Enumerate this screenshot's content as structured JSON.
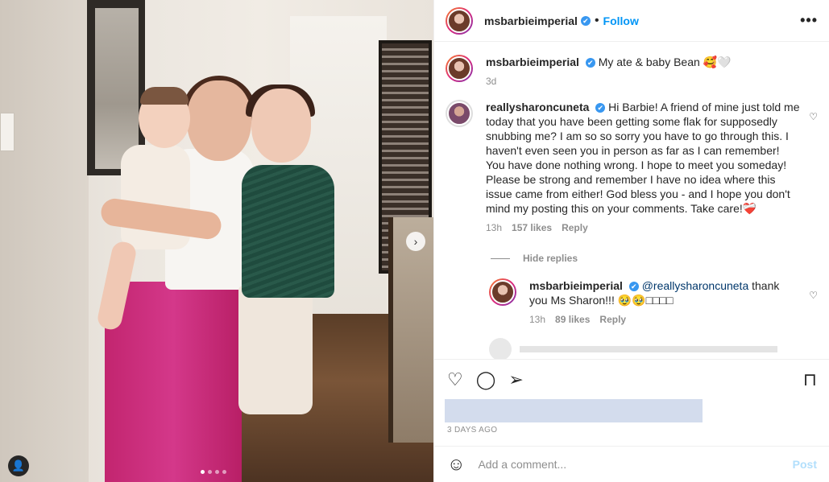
{
  "post": {
    "username": "msbarbieimperial",
    "follow_label": "Follow",
    "separator": "•",
    "more_label": "•••",
    "caption": "My ate & baby Bean 🥰🤍",
    "caption_age": "3d"
  },
  "comments": [
    {
      "username": "reallysharoncuneta",
      "text": "Hi Barbie! A friend of mine just told me today that you have been getting some flak for supposedly snubbing me? I am so so sorry you have to go through this. I haven't even seen you in person as far as I can remember! You have done nothing wrong. I hope to meet you someday! Please be strong and remember I have no idea where this issue came from either! God bless you - and I hope you don't mind my posting this on your comments. Take care!❤️‍🩹",
      "age": "13h",
      "likes": "157 likes",
      "reply_label": "Reply"
    }
  ],
  "hide_replies_label": "Hide replies",
  "reply": {
    "username": "msbarbieimperial",
    "mention": "@reallysharoncuneta",
    "text": " thank you Ms Sharon!!! 🥹🥹□□□□",
    "age": "13h",
    "likes": "89 likes",
    "reply_label": "Reply"
  },
  "footer": {
    "date": "3 DAYS AGO",
    "comment_placeholder": "Add a comment...",
    "post_label": "Post"
  },
  "icons": {
    "verified": "✔",
    "heart_small": "♡",
    "like": "♡",
    "comment": "◯",
    "share": "➢",
    "save": "⊓",
    "emoji": "☺",
    "user_tag": "👤",
    "next": "›"
  },
  "carousel": {
    "count": 4,
    "active": 1
  }
}
